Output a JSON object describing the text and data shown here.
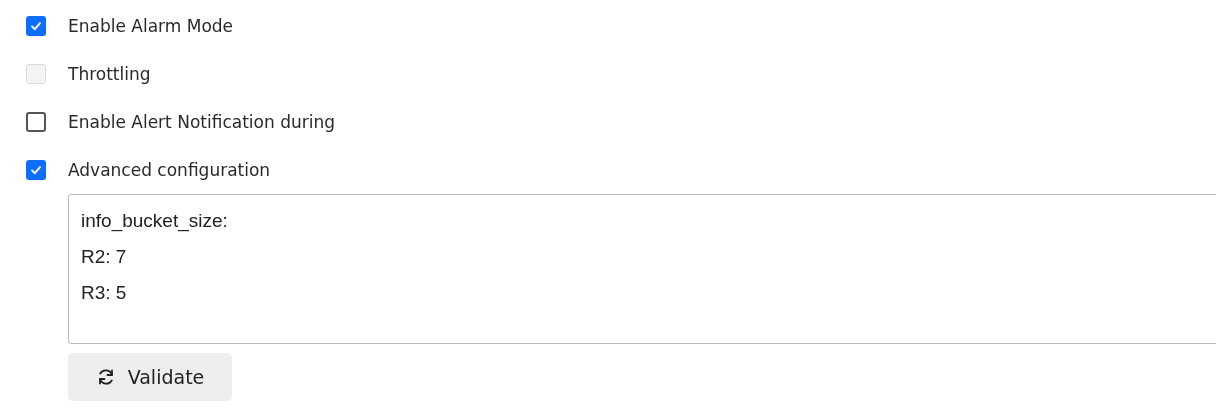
{
  "options": [
    {
      "label": "Enable Alarm Mode",
      "checked": true,
      "disabled": false
    },
    {
      "label": "Throttling",
      "checked": false,
      "disabled": true
    },
    {
      "label": "Enable Alert Notification during",
      "checked": false,
      "disabled": false
    },
    {
      "label": "Advanced configuration",
      "checked": true,
      "disabled": false
    }
  ],
  "config": {
    "lines": [
      "info_bucket_size:",
      "R2: 7",
      "R3: 5"
    ]
  },
  "validate_button": {
    "label": "Validate"
  }
}
